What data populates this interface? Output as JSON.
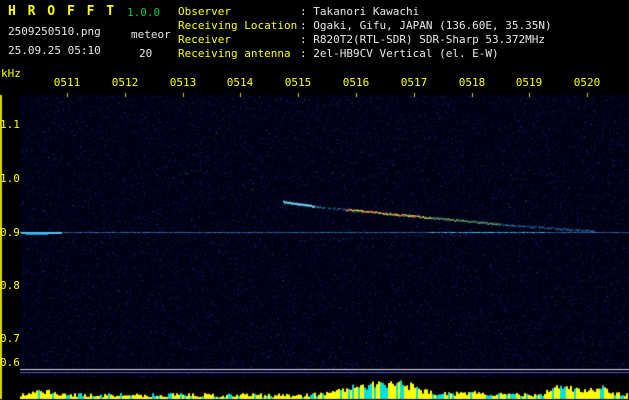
{
  "header": {
    "app_title": "H R O F F T",
    "version": "1.0.0",
    "filename": "2509250510.png",
    "mode": "meteor",
    "datetime": "25.09.25 05:10",
    "count": "20",
    "info_rows": [
      {
        "label": "Observer",
        "value": ": Takanori Kawachi"
      },
      {
        "label": "Receiving Location",
        "value": ": Ogaki, Gifu, JAPAN (136.60E, 35.35N)"
      },
      {
        "label": "Receiver",
        "value": ": R820T2(RTL-SDR) SDR-Sharp 53.372MHz"
      },
      {
        "label": "Receiving antenna",
        "value": ": 2el-HB9CV Vertical (el. E-W)"
      }
    ]
  },
  "chart_data": {
    "type": "heatmap",
    "subtype": "radio-meteor-spectrogram",
    "title": "HROFFT 10-minute meteor observation spectrogram",
    "ylabel": "kHz",
    "y_ticks": [
      "1.1",
      "1.0",
      "0.9",
      "0.8",
      "0.7",
      "0.6"
    ],
    "y_tick_values": [
      1.1,
      1.0,
      0.9,
      0.8,
      0.7,
      0.6
    ],
    "x_ticks": [
      "0511",
      "0512",
      "0513",
      "0514",
      "0515",
      "0516",
      "0517",
      "0518",
      "0519",
      "0520"
    ],
    "ylim": [
      0.6,
      1.17
    ],
    "grid": false,
    "legend": "none",
    "features": {
      "carrier_line": {
        "khz": 0.9,
        "color": "cyan",
        "description": "continuous direct-signal carrier line across full width"
      },
      "meteor_echo": {
        "time_start": "0515",
        "time_end": "0520",
        "khz_start": 1.0,
        "khz_end": 0.9,
        "core_colors": [
          "red",
          "yellow",
          "green"
        ],
        "description": "long-duration meteor echo drifting down in Doppler from ~1.0 kHz at 0515 to merge with 0.9 kHz carrier by ~0519"
      },
      "baseline_marker": {
        "khz": 0.62,
        "color": "white",
        "description": "horizontal white separator line near bottom of spectrogram"
      }
    },
    "colors": {
      "background": "#000014",
      "noise_blues": [
        "#0b0b38",
        "#12124e",
        "#1a1a6a",
        "#263c96"
      ],
      "axis_label": "#ffff00",
      "carrier_cyan": "#38a0e8",
      "carrier_bright": "#50d8ff",
      "echo_red": "#ff5050",
      "echo_yellow": "#ffe050",
      "echo_green": "#a0ff80",
      "echo_cyan": "#55c8ff",
      "baseline_white": "#d8d8e8",
      "baseline_dim": "#5858a0",
      "bar": "#ffff00",
      "bar_alt": "#00e0e0",
      "frame_yellow": "#d8d800"
    },
    "level_bars": {
      "description": "per-second signal level bars along bottom strip, yellow with cyan mixed",
      "peaks_near": [
        "0516",
        "0517",
        "0519",
        "0520"
      ],
      "bumps": [
        {
          "center": 45,
          "width": 18,
          "boost": 5
        },
        {
          "center": 360,
          "width": 28,
          "boost": 11
        },
        {
          "center": 400,
          "width": 26,
          "boost": 13
        },
        {
          "center": 470,
          "width": 18,
          "boost": 4
        },
        {
          "center": 563,
          "width": 16,
          "boost": 12
        },
        {
          "center": 598,
          "width": 14,
          "boost": 9
        }
      ]
    }
  }
}
